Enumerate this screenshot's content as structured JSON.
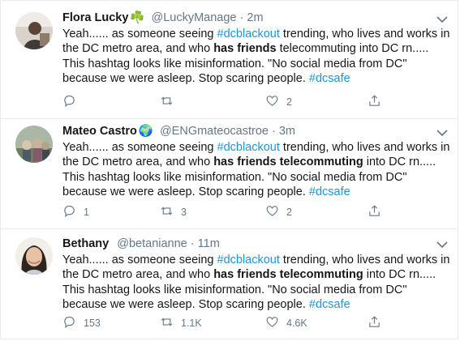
{
  "tweets": [
    {
      "name": "Flora Lucky",
      "name_badge": "☘️",
      "handle": "@LuckyManage",
      "separator": "·",
      "time": "2m",
      "text_parts": [
        {
          "t": "Yeah...... as someone seeing "
        },
        {
          "t": "#dcblackout",
          "style": "hashtag"
        },
        {
          "t": " trending, who lives and works in the DC metro area, and who "
        },
        {
          "t": "has friends",
          "style": "bold"
        },
        {
          "t": " telecommuting into DC rn..... This hashtag looks like misinformation. \"No social media from DC\" because we were asleep. Stop scaring people. "
        },
        {
          "t": "#dcsafe",
          "style": "hashtag"
        }
      ],
      "reply_count": "",
      "retweet_count": "",
      "like_count": "2"
    },
    {
      "name": "Mateo Castro",
      "name_badge": "🌍",
      "handle": "@ENGmateocastroe",
      "separator": "·",
      "time": "3m",
      "text_parts": [
        {
          "t": "Yeah...... as someone seeing "
        },
        {
          "t": "#dcblackout",
          "style": "hashtag"
        },
        {
          "t": " trending, who lives and works in the DC metro area, and who "
        },
        {
          "t": "has friends telecommuting",
          "style": "bold"
        },
        {
          "t": " into DC rn..... This hashtag looks like misinformation. \"No social media from DC\" because we were asleep. Stop scaring people. "
        },
        {
          "t": "#dcsafe",
          "style": "hashtag"
        }
      ],
      "reply_count": "1",
      "retweet_count": "3",
      "like_count": "2"
    },
    {
      "name": "Bethany",
      "name_badge": "",
      "handle": "@betanianne",
      "separator": "·",
      "time": "11m",
      "text_parts": [
        {
          "t": "Yeah...... as someone seeing "
        },
        {
          "t": "#dcblackout",
          "style": "hashtag"
        },
        {
          "t": " trending, who lives and works in the DC metro area, and who "
        },
        {
          "t": "has friends telecommuting",
          "style": "bold"
        },
        {
          "t": " into DC rn..... This hashtag looks like misinformation. \"No social media from DC\" because we were asleep. Stop scaring people. "
        },
        {
          "t": "#dcsafe",
          "style": "hashtag"
        }
      ],
      "reply_count": "153",
      "retweet_count": "1.1K",
      "like_count": "4.6K"
    }
  ],
  "icons": {
    "reply": "reply-icon",
    "retweet": "retweet-icon",
    "like": "heart-icon",
    "share": "share-icon",
    "more": "chevron-down-icon"
  },
  "colors": {
    "text": "#14171a",
    "secondary": "#657786",
    "hashtag": "#1b95e0",
    "divider": "#e6ecf0"
  }
}
